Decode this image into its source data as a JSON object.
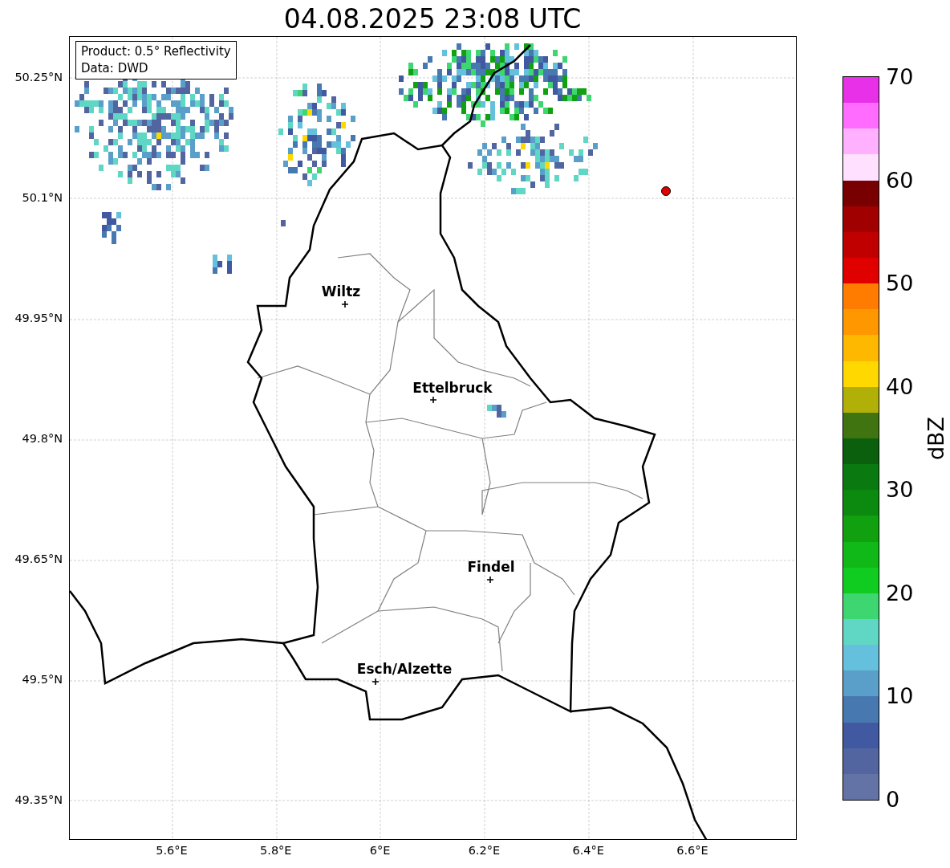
{
  "title": "04.08.2025 23:08 UTC",
  "info_box": [
    "Product: 0.5° Reflectivity",
    "Data: DWD"
  ],
  "y_ticks": [
    "50.25°N",
    "50.1°N",
    "49.95°N",
    "49.8°N",
    "49.65°N",
    "49.5°N",
    "49.35°N"
  ],
  "x_ticks": [
    "5.6°E",
    "5.8°E",
    "6°E",
    "6.2°E",
    "6.4°E",
    "6.6°E"
  ],
  "cities": [
    {
      "name": "Wiltz"
    },
    {
      "name": "Ettelbruck"
    },
    {
      "name": "Findel"
    },
    {
      "name": "Esch/Alzette"
    }
  ],
  "colorbar": {
    "label": "dBZ",
    "ticks": [
      "70",
      "60",
      "50",
      "40",
      "30",
      "20",
      "10",
      "0"
    ],
    "segments": [
      {
        "color": "#e830e8"
      },
      {
        "color": "#ff6cff"
      },
      {
        "color": "#ffb0ff"
      },
      {
        "color": "#ffe0ff"
      },
      {
        "color": "#780000"
      },
      {
        "color": "#a00000"
      },
      {
        "color": "#c00000"
      },
      {
        "color": "#e00000"
      },
      {
        "color": "#ff7c00"
      },
      {
        "color": "#ff9800"
      },
      {
        "color": "#ffb800"
      },
      {
        "color": "#ffd800"
      },
      {
        "color": "#b0b008"
      },
      {
        "color": "#3f7410"
      },
      {
        "color": "#0a600c"
      },
      {
        "color": "#0a7a10"
      },
      {
        "color": "#0c8a10"
      },
      {
        "color": "#10a010"
      },
      {
        "color": "#10b818"
      },
      {
        "color": "#10cc20"
      },
      {
        "color": "#3ed670"
      },
      {
        "color": "#60d6c4"
      },
      {
        "color": "#64c0dc"
      },
      {
        "color": "#5a9fc9"
      },
      {
        "color": "#4878b0"
      },
      {
        "color": "#4159a0"
      },
      {
        "color": "#5265a0"
      },
      {
        "color": "#6373a5"
      }
    ]
  }
}
